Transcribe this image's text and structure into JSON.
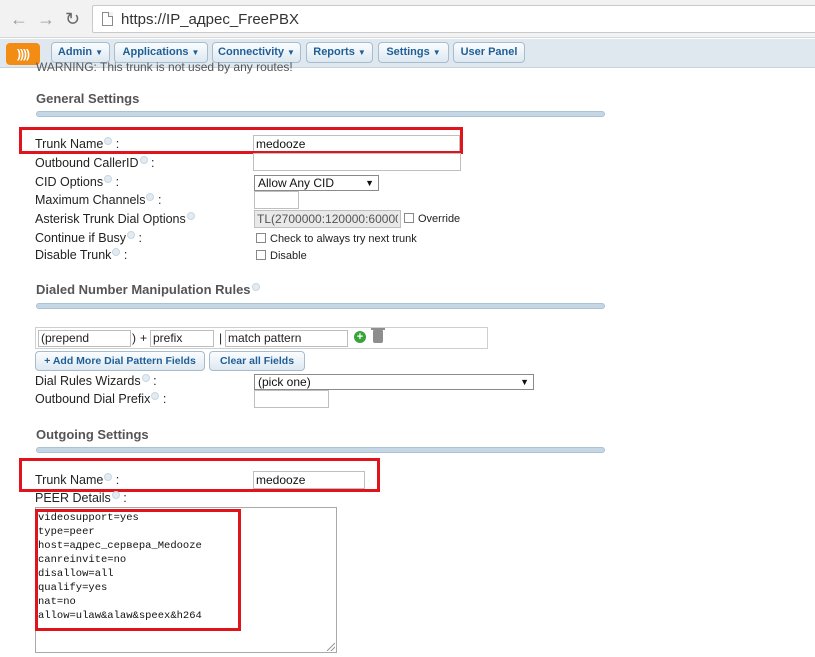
{
  "browser": {
    "url": "https://IP_адрес_FreePBX"
  },
  "menu": {
    "logo_text": "))))",
    "items": [
      {
        "label": "Admin",
        "caret": "▼"
      },
      {
        "label": "Applications",
        "caret": "▼"
      },
      {
        "label": "Connectivity",
        "caret": "▼"
      },
      {
        "label": "Reports",
        "caret": "▼"
      },
      {
        "label": "Settings",
        "caret": "▼"
      },
      {
        "label": "User Panel",
        "caret": ""
      }
    ]
  },
  "warning": "WARNING: This trunk is not used by any routes!",
  "general": {
    "title": "General Settings",
    "trunk_name_label": "Trunk Name",
    "trunk_name_value": "medooze",
    "outbound_callerid_label": "Outbound CallerID",
    "outbound_callerid_value": "",
    "cid_options_label": "CID Options",
    "cid_options_value": "Allow Any CID",
    "max_channels_label": "Maximum Channels",
    "max_channels_value": "",
    "dial_options_label": "Asterisk Trunk Dial Options",
    "dial_options_value": "TL(2700000:120000:60000",
    "override_label": "Override",
    "continue_busy_label": "Continue if Busy",
    "continue_busy_text": "Check to always try next trunk",
    "disable_trunk_label": "Disable Trunk",
    "disable_text": "Disable"
  },
  "dialed": {
    "title": "Dialed Number Manipulation Rules",
    "prepend": "(prepend",
    "close_paren": ")",
    "plus": "+",
    "prefix": "prefix",
    "bar": "|",
    "match_pattern": "match pattern",
    "add_more_label": "+ Add More Dial Pattern Fields",
    "clear_all_label": "Clear all Fields",
    "wizards_label": "Dial Rules Wizards",
    "wizards_value": "(pick one)",
    "outbound_prefix_label": "Outbound Dial Prefix",
    "outbound_prefix_value": ""
  },
  "outgoing": {
    "title": "Outgoing Settings",
    "trunk_name_label": "Trunk Name",
    "trunk_name_value": "medooze",
    "peer_details_label": "PEER Details",
    "peer_lines": [
      "videosupport=yes",
      "type=peer",
      "host=адрес_сервера_Medooze",
      "canreinvite=no",
      "disallow=all",
      "qualify=yes",
      "nat=no",
      "allow=ulaw&alaw&speex&h264"
    ]
  },
  "colors": {
    "highlight_box": "#e0141d",
    "menu_text": "#1f5f96",
    "logo": "#f28c13"
  }
}
